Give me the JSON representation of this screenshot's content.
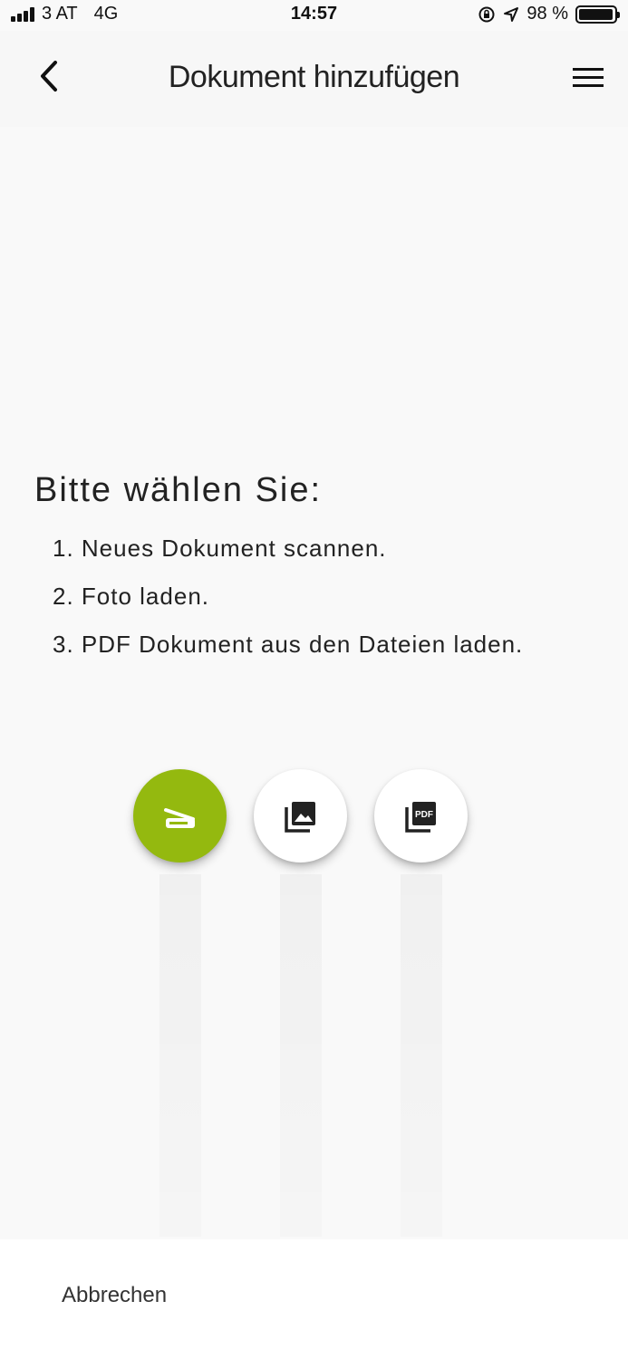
{
  "status_bar": {
    "carrier": "3 AT",
    "network": "4G",
    "time": "14:57",
    "battery": "98 %",
    "battery_level": 0.98,
    "icons": [
      "signal-icon",
      "orientation-lock-icon",
      "location-icon",
      "battery-icon"
    ]
  },
  "nav": {
    "title": "Dokument hinzufügen",
    "back_icon": "chevron-left-icon",
    "menu_icon": "hamburger-menu-icon"
  },
  "instructions": {
    "heading": "Bitte wählen Sie:",
    "steps": [
      "1. Neues Dokument scannen.",
      "2. Foto laden.",
      "3. PDF Dokument aus den Dateien laden."
    ]
  },
  "actions": {
    "scan": {
      "icon": "scanner-icon",
      "color": "#94b90f"
    },
    "photo": {
      "icon": "photo-library-icon"
    },
    "pdf": {
      "icon": "pdf-icon",
      "label": "PDF"
    }
  },
  "footer": {
    "cancel_label": "Abbrechen"
  }
}
